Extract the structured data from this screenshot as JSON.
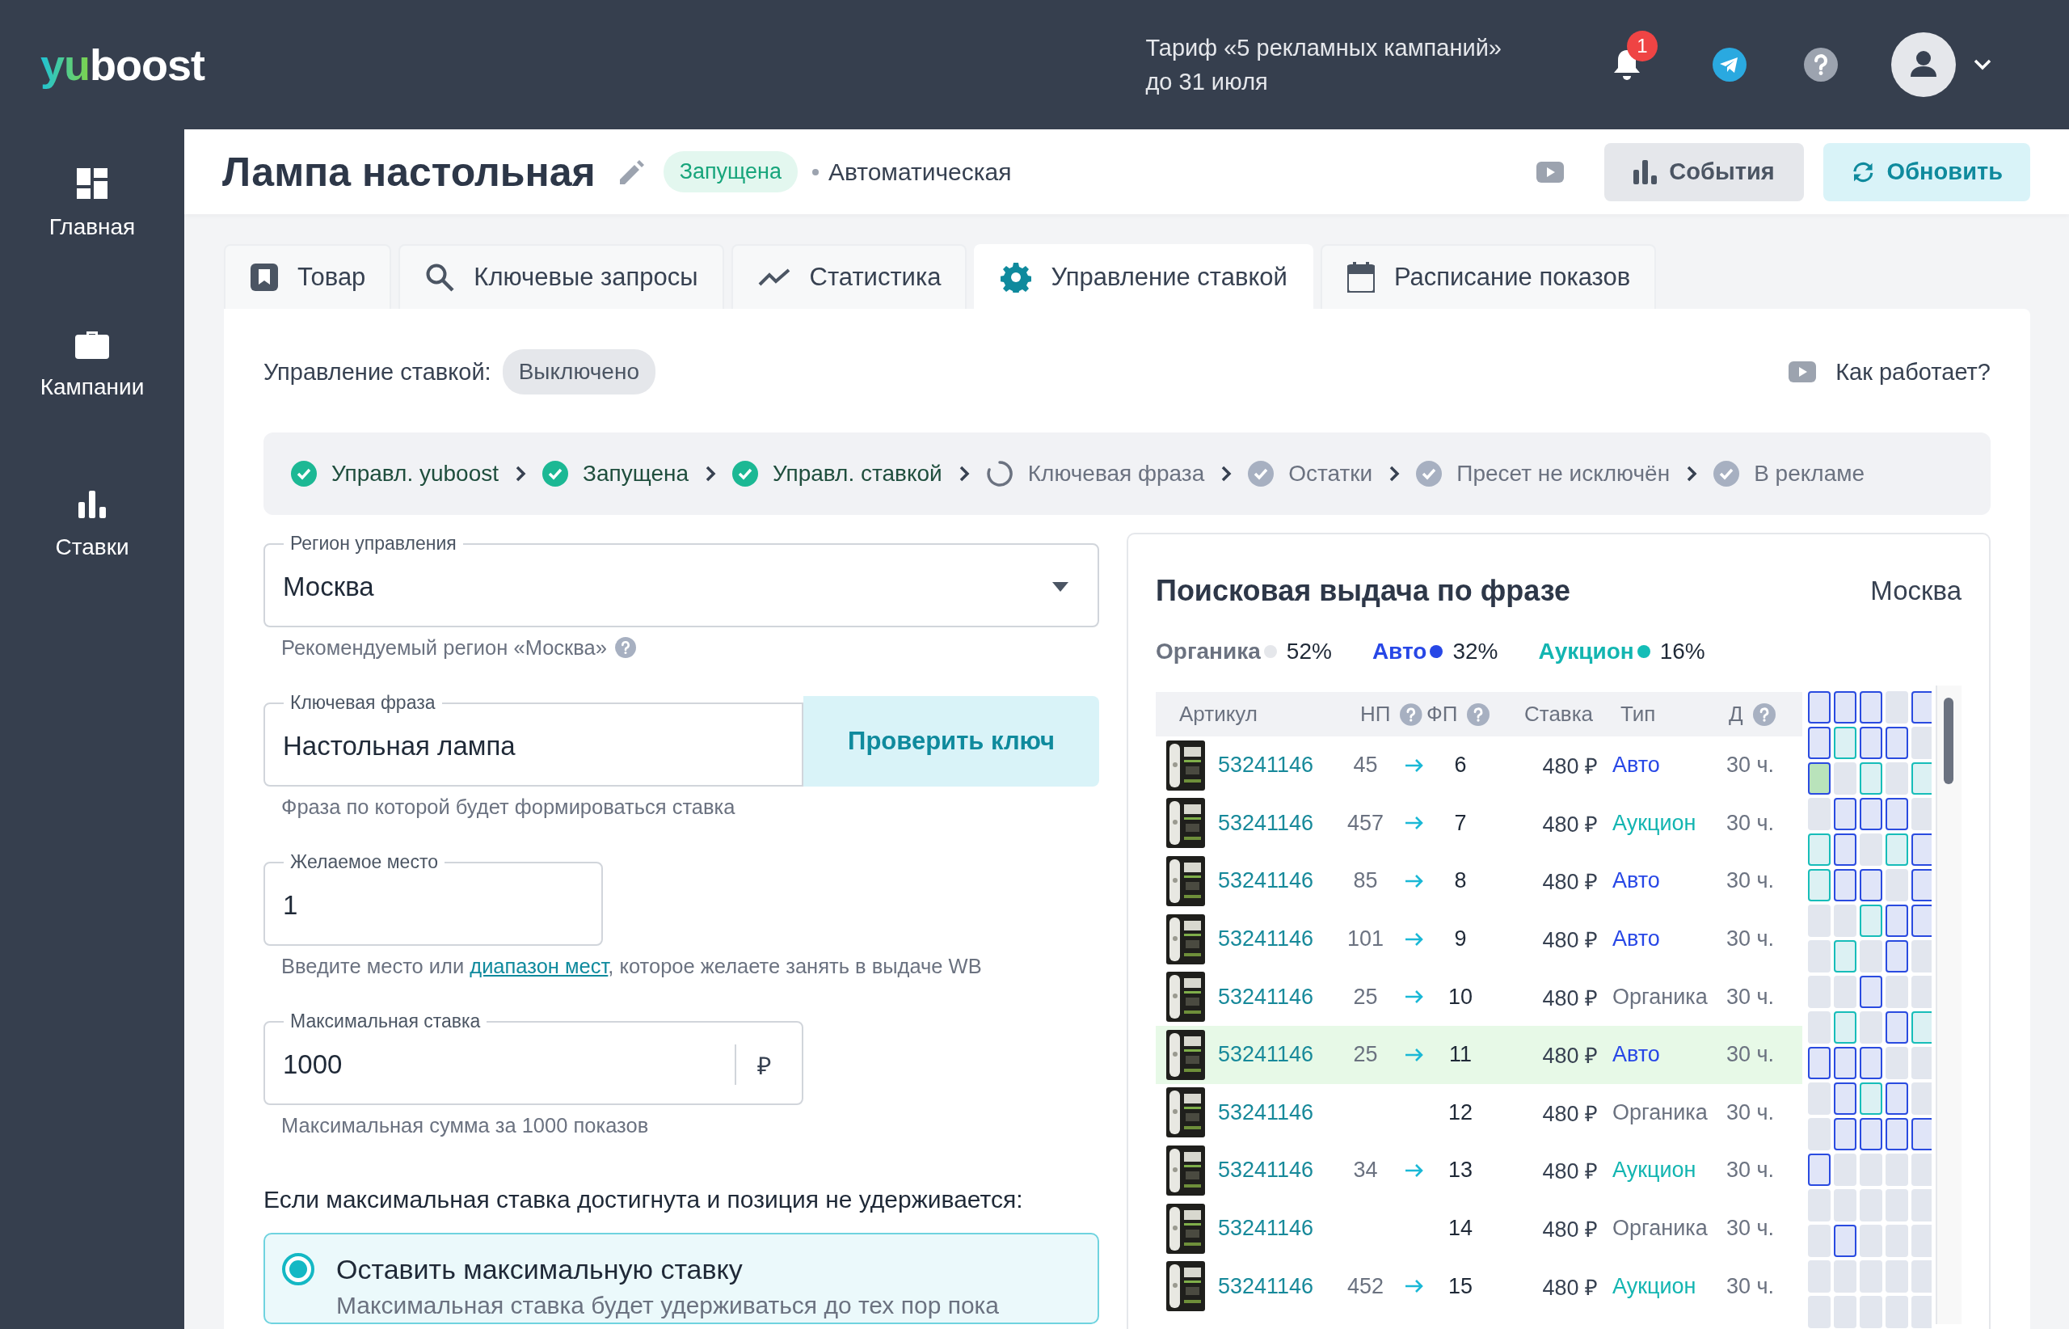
{
  "header": {
    "logo": [
      {
        "text": "yu",
        "kind": "accent"
      },
      {
        "text": "boost",
        "kind": "plain"
      }
    ],
    "tariff_lines": [
      "Тариф «5 рекламных кампаний»",
      "до 31 июля"
    ],
    "notifications": "1"
  },
  "sidebar": {
    "items": [
      {
        "label": "Главная"
      },
      {
        "label": "Кампании"
      },
      {
        "label": "Ставки"
      }
    ]
  },
  "title_bar": {
    "title": "Лампа настольная",
    "status": "Запущена",
    "mode": "Автоматическая",
    "buttons": [
      {
        "label": "События",
        "kind": "secondary"
      },
      {
        "label": "Обновить",
        "kind": "primary"
      }
    ]
  },
  "tabs": [
    {
      "label": "Товар",
      "selected": false
    },
    {
      "label": "Ключевые запросы",
      "selected": false
    },
    {
      "label": "Статистика",
      "selected": false
    },
    {
      "label": "Управление ставкой",
      "selected": true
    },
    {
      "label": "Расписание показов",
      "selected": false
    }
  ],
  "bid_control": {
    "label": "Управление ставкой:",
    "status": "Выключено",
    "help_link": "Как работает?"
  },
  "steps": [
    {
      "label": "Управл. yuboost",
      "kind": "done"
    },
    {
      "label": "Запущена",
      "kind": "done"
    },
    {
      "label": "Управл. ставкой",
      "kind": "done"
    },
    {
      "label": "Ключевая фраза",
      "kind": "progress"
    },
    {
      "label": "Остатки",
      "kind": "pending"
    },
    {
      "label": "Пресет не исключён",
      "kind": "pending"
    },
    {
      "label": "В рекламе",
      "kind": "pending"
    }
  ],
  "form": {
    "region": {
      "label": "Регион управления",
      "value": "Москва",
      "hint": "Рекомендуемый регион «Москва»"
    },
    "keyword": {
      "label": "Ключевая фраза",
      "value": "Настольная лампа",
      "button": "Проверить ключ",
      "hint": "Фраза по которой будет формироваться ставка"
    },
    "place": {
      "label": "Желаемое место",
      "value": "1",
      "hint": "Введите место или ",
      "hint_link": "диапазон мест",
      "hint_end": ", которое желаете занять в выдаче WB"
    },
    "max_bid": {
      "label": "Максимальная ставка",
      "value": "1000",
      "suffix": "₽",
      "hint": "Максимальная сумма за 1000 показов"
    },
    "fallback": {
      "question": "Если максимальная ставка достигнута и позиция не удерживается:",
      "options": [
        {
          "title": "Оставить максимальную ставку",
          "description": "Максимальная ставка будет удерживаться до тех пор пока",
          "selected": true
        }
      ]
    }
  },
  "serp": {
    "title": "Поисковая выдача по фразе",
    "region": "Москва",
    "legend": [
      {
        "label": "Органика",
        "kind": "organic",
        "color": "#e5e7eb",
        "share": "52%"
      },
      {
        "label": "Авто",
        "kind": "auto",
        "color": "#2747e6",
        "share": "32%"
      },
      {
        "label": "Аукцион",
        "kind": "auction",
        "color": "#13bdb7",
        "share": "16%"
      }
    ],
    "columns": [
      {
        "label": "Артикул",
        "help": false
      },
      {
        "label": "НП",
        "help": true
      },
      {
        "label": "ФП",
        "help": true
      },
      {
        "label": "Ставка",
        "help": false
      },
      {
        "label": "Тип",
        "help": false
      },
      {
        "label": "Д",
        "help": true
      }
    ],
    "rows": [
      {
        "article": "53241146",
        "np": "45",
        "fp": "6",
        "bid": "480 ₽",
        "type": {
          "text": "Авто",
          "kind": "auto"
        },
        "d": "30 ч.",
        "highlighted": false
      },
      {
        "article": "53241146",
        "np": "457",
        "fp": "7",
        "bid": "480 ₽",
        "type": {
          "text": "Аукцион",
          "kind": "auction"
        },
        "d": "30 ч.",
        "highlighted": false
      },
      {
        "article": "53241146",
        "np": "85",
        "fp": "8",
        "bid": "480 ₽",
        "type": {
          "text": "Авто",
          "kind": "auto"
        },
        "d": "30 ч.",
        "highlighted": false
      },
      {
        "article": "53241146",
        "np": "101",
        "fp": "9",
        "bid": "480 ₽",
        "type": {
          "text": "Авто",
          "kind": "auto"
        },
        "d": "30 ч.",
        "highlighted": false
      },
      {
        "article": "53241146",
        "np": "25",
        "fp": "10",
        "bid": "480 ₽",
        "type": {
          "text": "Органика",
          "kind": "organic"
        },
        "d": "30 ч.",
        "highlighted": false
      },
      {
        "article": "53241146",
        "np": "25",
        "fp": "11",
        "bid": "480 ₽",
        "type": {
          "text": "Авто",
          "kind": "auto"
        },
        "d": "30 ч.",
        "highlighted": true
      },
      {
        "article": "53241146",
        "fp": "12",
        "bid": "480 ₽",
        "type": {
          "text": "Органика",
          "kind": "organic"
        },
        "d": "30 ч.",
        "highlighted": false
      },
      {
        "article": "53241146",
        "np": "34",
        "fp": "13",
        "bid": "480 ₽",
        "type": {
          "text": "Аукцион",
          "kind": "auction"
        },
        "d": "30 ч.",
        "highlighted": false
      },
      {
        "article": "53241146",
        "fp": "14",
        "bid": "480 ₽",
        "type": {
          "text": "Органика",
          "kind": "organic"
        },
        "d": "30 ч.",
        "highlighted": false
      },
      {
        "article": "53241146",
        "np": "452",
        "fp": "15",
        "bid": "480 ₽",
        "type": {
          "text": "Аукцион",
          "kind": "auction"
        },
        "d": "30 ч.",
        "highlighted": false
      }
    ],
    "position_map": [
      [
        {
          "kind": "auto"
        },
        {
          "kind": "auto"
        },
        {
          "kind": "auto"
        },
        {
          "kind": "empty"
        },
        {
          "kind": "auto"
        }
      ],
      [
        {
          "kind": "auto"
        },
        {
          "kind": "auction"
        },
        {
          "kind": "auto"
        },
        {
          "kind": "auto"
        },
        {
          "kind": "empty"
        }
      ],
      [
        {
          "kind": "own"
        },
        {
          "kind": "empty"
        },
        {
          "kind": "auction"
        },
        {
          "kind": "empty"
        },
        {
          "kind": "auction"
        }
      ],
      [
        {
          "kind": "empty"
        },
        {
          "kind": "auto"
        },
        {
          "kind": "auto"
        },
        {
          "kind": "auto"
        },
        {
          "kind": "empty"
        }
      ],
      [
        {
          "kind": "auction"
        },
        {
          "kind": "auto"
        },
        {
          "kind": "empty"
        },
        {
          "kind": "auction"
        },
        {
          "kind": "auto"
        }
      ],
      [
        {
          "kind": "auction"
        },
        {
          "kind": "auto"
        },
        {
          "kind": "auto"
        },
        {
          "kind": "empty"
        },
        {
          "kind": "auto"
        }
      ],
      [
        {
          "kind": "empty"
        },
        {
          "kind": "empty"
        },
        {
          "kind": "auction"
        },
        {
          "kind": "auto"
        },
        {
          "kind": "auto"
        }
      ],
      [
        {
          "kind": "empty"
        },
        {
          "kind": "auction"
        },
        {
          "kind": "empty"
        },
        {
          "kind": "auto"
        },
        {
          "kind": "empty"
        }
      ],
      [
        {
          "kind": "empty"
        },
        {
          "kind": "empty"
        },
        {
          "kind": "auto"
        },
        {
          "kind": "empty"
        },
        {
          "kind": "empty"
        }
      ],
      [
        {
          "kind": "empty"
        },
        {
          "kind": "auction"
        },
        {
          "kind": "empty"
        },
        {
          "kind": "auto"
        },
        {
          "kind": "auction"
        }
      ],
      [
        {
          "kind": "auto"
        },
        {
          "kind": "auto"
        },
        {
          "kind": "auto"
        },
        {
          "kind": "empty"
        },
        {
          "kind": "empty"
        }
      ],
      [
        {
          "kind": "empty"
        },
        {
          "kind": "auto"
        },
        {
          "kind": "auction"
        },
        {
          "kind": "auto"
        },
        {
          "kind": "empty"
        }
      ],
      [
        {
          "kind": "empty"
        },
        {
          "kind": "auto"
        },
        {
          "kind": "auto"
        },
        {
          "kind": "auto"
        },
        {
          "kind": "auto"
        }
      ],
      [
        {
          "kind": "auto"
        },
        {
          "kind": "empty"
        },
        {
          "kind": "empty"
        },
        {
          "kind": "empty"
        },
        {
          "kind": "empty"
        }
      ],
      [
        {
          "kind": "empty"
        },
        {
          "kind": "empty"
        },
        {
          "kind": "empty"
        },
        {
          "kind": "empty"
        },
        {
          "kind": "empty"
        }
      ],
      [
        {
          "kind": "empty"
        },
        {
          "kind": "auto"
        },
        {
          "kind": "empty"
        },
        {
          "kind": "empty"
        },
        {
          "kind": "empty"
        }
      ],
      [
        {
          "kind": "empty"
        },
        {
          "kind": "empty"
        },
        {
          "kind": "empty"
        },
        {
          "kind": "empty"
        },
        {
          "kind": "empty"
        }
      ],
      [
        {
          "kind": "empty"
        },
        {
          "kind": "empty"
        },
        {
          "kind": "empty"
        },
        {
          "kind": "empty"
        },
        {
          "kind": "empty"
        }
      ]
    ]
  }
}
